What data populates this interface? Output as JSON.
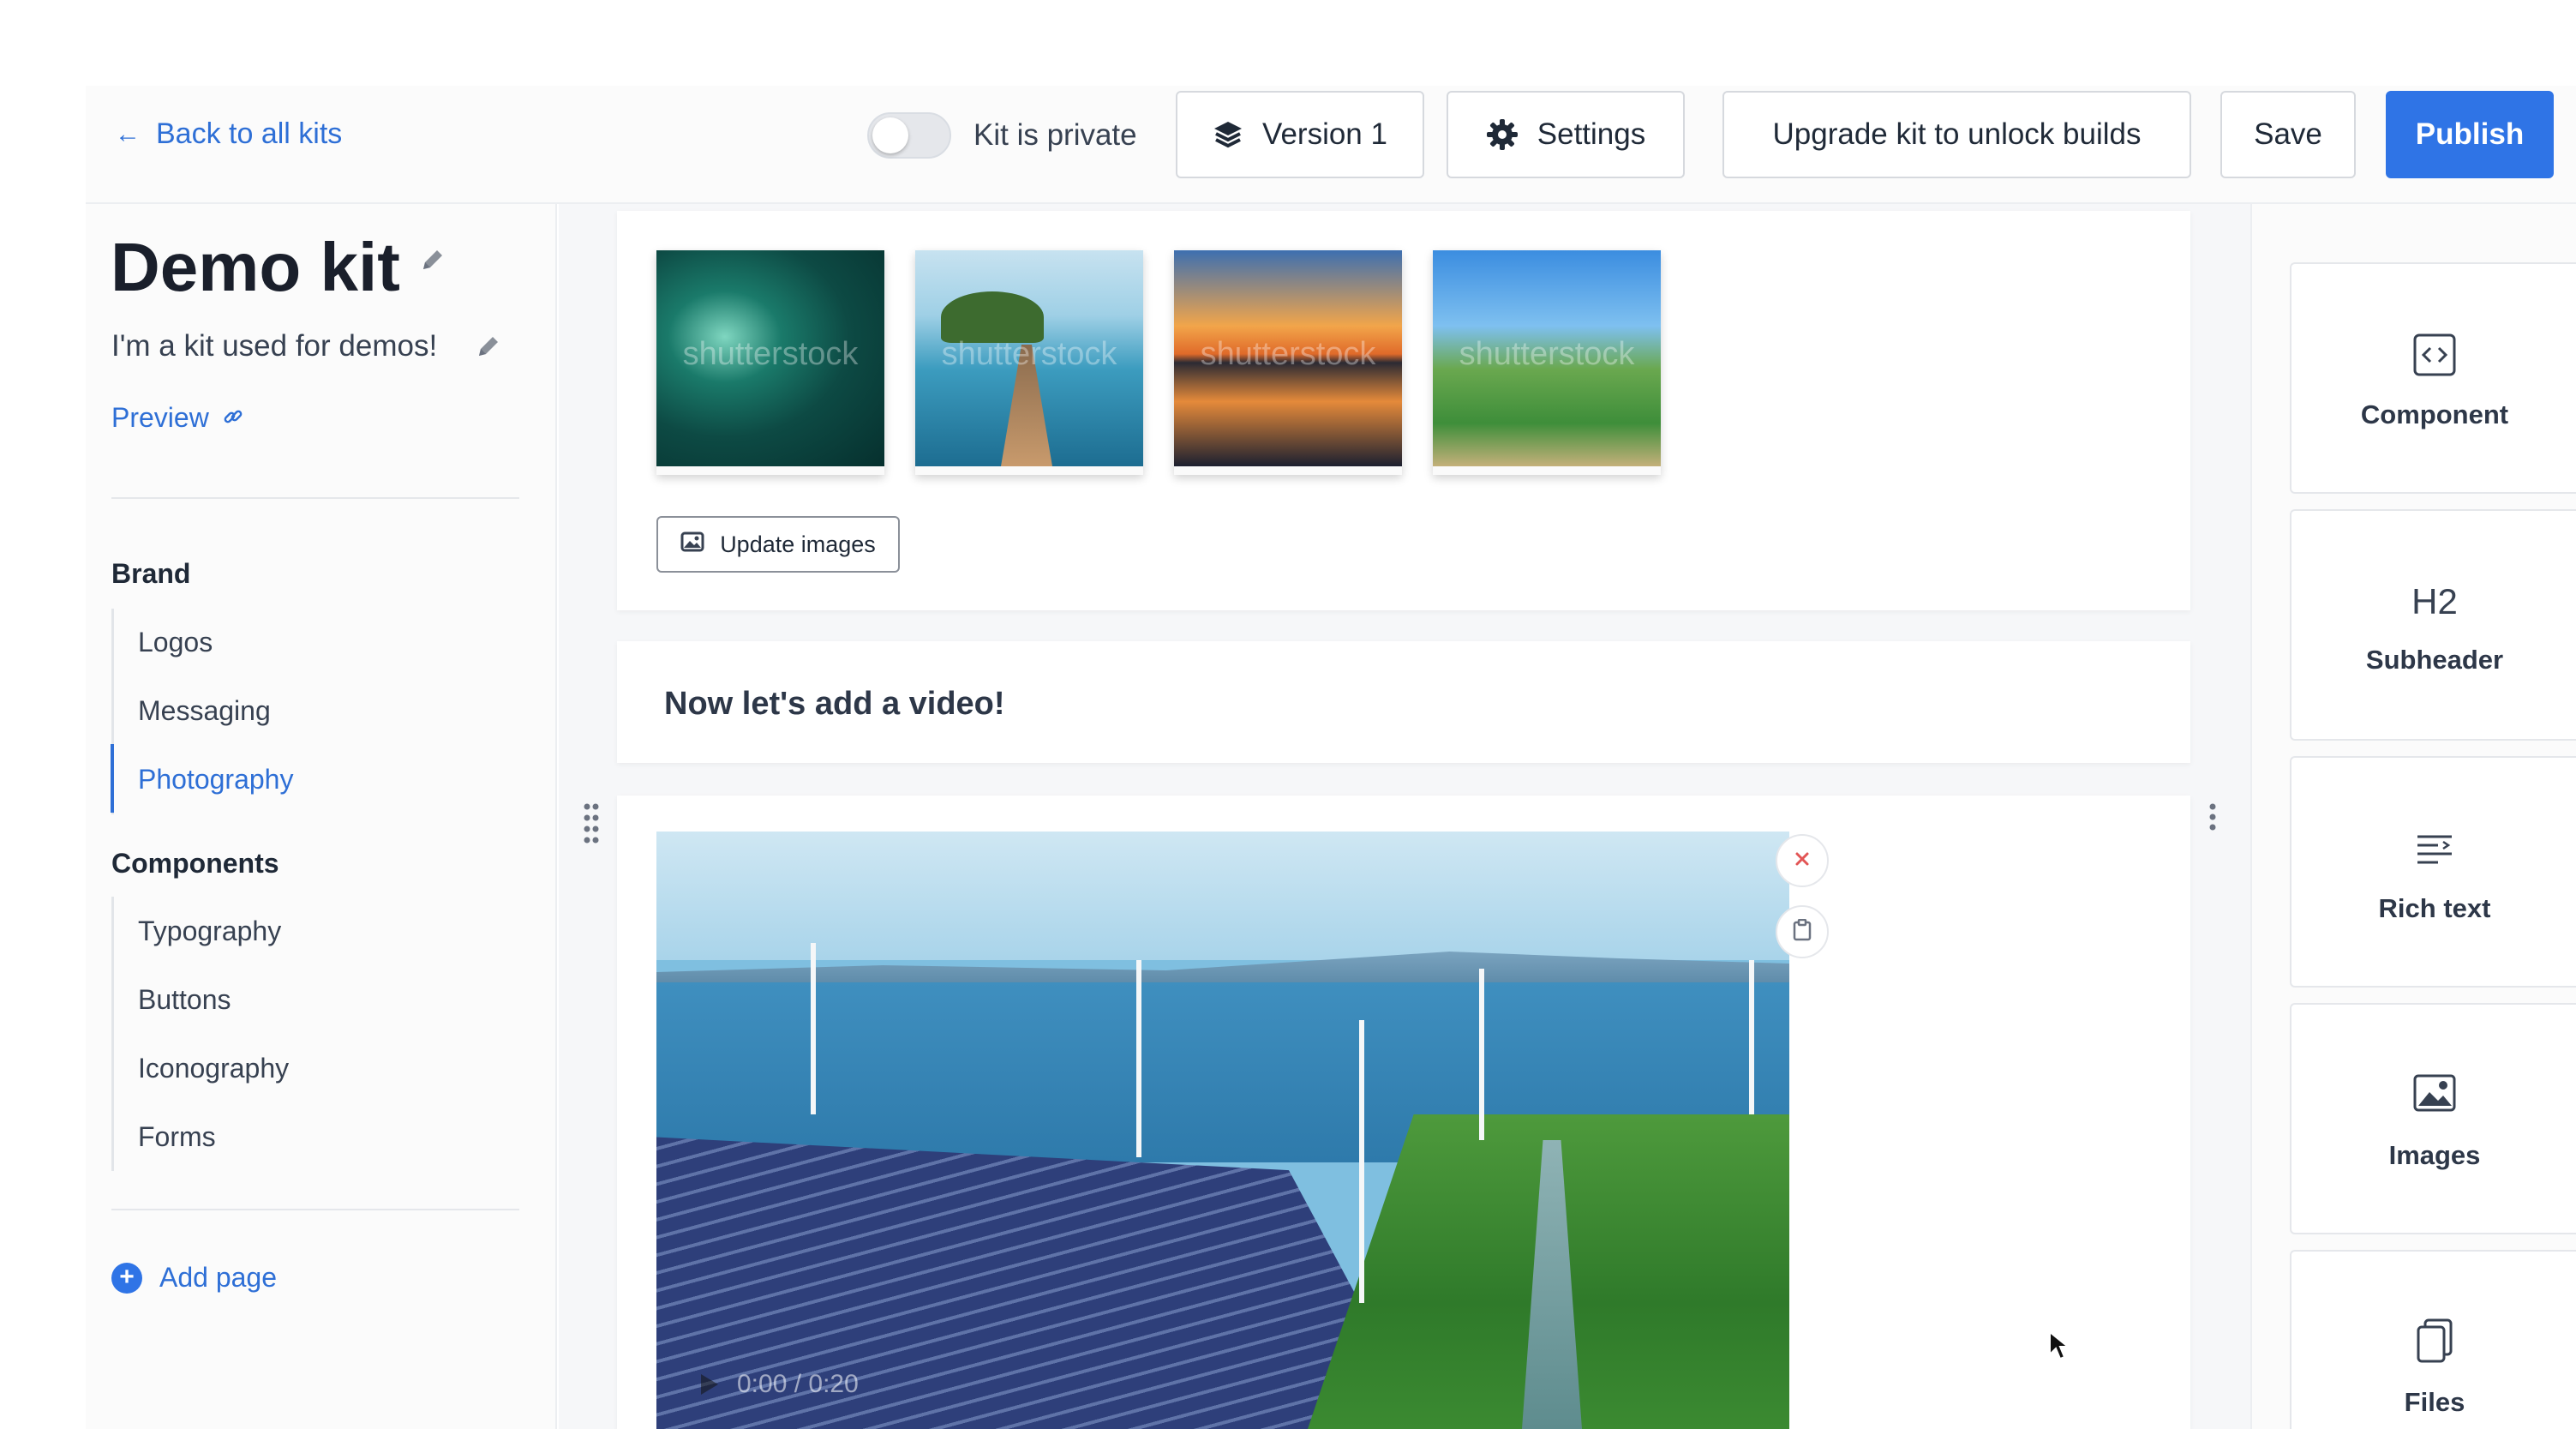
{
  "header": {
    "back_label": "Back to all kits",
    "privacy_label": "Kit is private",
    "privacy_enabled": false,
    "version_label": "Version 1",
    "settings_label": "Settings",
    "upgrade_label": "Upgrade kit to unlock builds",
    "save_label": "Save",
    "publish_label": "Publish"
  },
  "kit": {
    "title": "Demo kit",
    "description": "I'm a kit used for demos!",
    "preview_label": "Preview"
  },
  "sidebar": {
    "sections": [
      {
        "title": "Brand",
        "items": [
          "Logos",
          "Messaging",
          "Photography"
        ]
      },
      {
        "title": "Components",
        "items": [
          "Typography",
          "Buttons",
          "Iconography",
          "Forms"
        ]
      }
    ],
    "active_item": "Photography",
    "add_page_label": "Add page"
  },
  "editor": {
    "images": {
      "thumbnails": [
        "ocean-waves-aerial",
        "pier-to-island",
        "sunset-lake",
        "meadow-river"
      ],
      "watermark": "shutterstock",
      "update_label": "Update images"
    },
    "heading_block": {
      "text": "Now let's add a video!"
    },
    "video_block": {
      "scene": "wind-turbines-solar-farm",
      "timecode": "0:00 / 0:20"
    }
  },
  "blocks_panel": {
    "items": [
      {
        "label": "Component",
        "icon": "code-brackets-icon"
      },
      {
        "label": "Subheader",
        "icon": "h2-icon",
        "glyph": "H2"
      },
      {
        "label": "Rich text",
        "icon": "rich-text-icon"
      },
      {
        "label": "Images",
        "icon": "image-icon"
      },
      {
        "label": "Files",
        "icon": "files-icon"
      }
    ]
  },
  "colors": {
    "accent": "#2f74e6",
    "link": "#2e6fd6",
    "close_x": "#e25555"
  }
}
